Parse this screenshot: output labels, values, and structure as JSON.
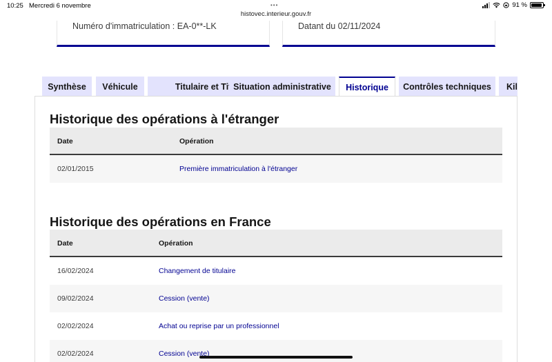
{
  "statusbar": {
    "time": "10:25",
    "date": "Mercredi 6 novembre",
    "url": "histovec.interieur.gouv.fr",
    "battery": "91 %",
    "battery_level": 0.91,
    "icons": [
      "signal-icon",
      "wifi-icon",
      "orientation-lock-icon",
      "battery-icon"
    ]
  },
  "cards": {
    "registration": "Numéro d'immatriculation : EA-0**-LK",
    "date": "Datant du 02/11/2024"
  },
  "tabs": [
    {
      "label": "Synthèse",
      "active": false
    },
    {
      "label": "Véhicule",
      "active": false
    },
    {
      "label": "Titulaire et Titre",
      "active": false
    },
    {
      "label": "Situation administrative",
      "active": false
    },
    {
      "label": "Historique",
      "active": true
    },
    {
      "label": "Contrôles techniques",
      "active": false
    },
    {
      "label": "Kilométrage",
      "active": false
    }
  ],
  "foreign": {
    "title": "Historique des opérations à l'étranger",
    "headers": {
      "date": "Date",
      "operation": "Opération"
    },
    "rows": [
      {
        "date": "02/01/2015",
        "operation": "Première immatriculation à l'étranger"
      }
    ]
  },
  "france": {
    "title": "Historique des opérations en France",
    "headers": {
      "date": "Date",
      "operation": "Opération"
    },
    "rows": [
      {
        "date": "16/02/2024",
        "operation": "Changement de titulaire"
      },
      {
        "date": "09/02/2024",
        "operation": "Cession (vente)"
      },
      {
        "date": "02/02/2024",
        "operation": "Achat ou reprise par un professionnel"
      },
      {
        "date": "02/02/2024",
        "operation": "Cession (vente)"
      }
    ]
  },
  "colors": {
    "accent": "#000091",
    "tab_bg": "#e3e3fd",
    "header_bg": "#ebebeb"
  }
}
